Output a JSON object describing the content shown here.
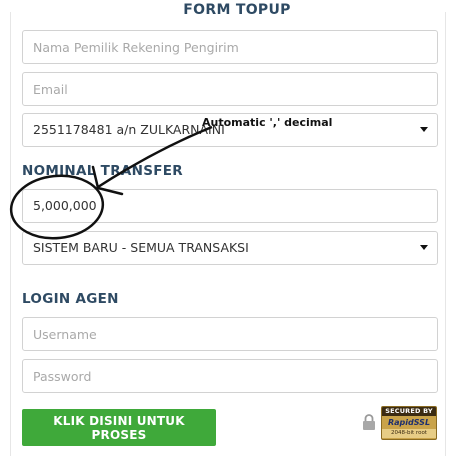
{
  "form": {
    "title": "FORM TOPUP",
    "name_placeholder": "Nama Pemilik Rekening Pengirim",
    "email_placeholder": "Email",
    "bank_account_value": "2551178481 a/n ZULKARNAINI",
    "nominal_label": "NOMINAL TRANSFER",
    "nominal_value": "5,000,000",
    "system_value": "SISTEM BARU - SEMUA TRANSAKSI"
  },
  "login": {
    "label": "LOGIN AGEN",
    "username_placeholder": "Username",
    "password_placeholder": "Password"
  },
  "submit_label": "KLIK DISINI UNTUK PROSES",
  "ssl_badge": {
    "top": "SECURED BY",
    "brand": "RapidSSL",
    "bottom": "2048-bit root"
  },
  "annotation": {
    "text": "Automatic ',' decimal"
  },
  "colors": {
    "heading": "#2e4a63",
    "button": "#3fa93a"
  },
  "icons": {
    "lock": "lock-icon",
    "dropdown": "chevron-down-icon"
  }
}
